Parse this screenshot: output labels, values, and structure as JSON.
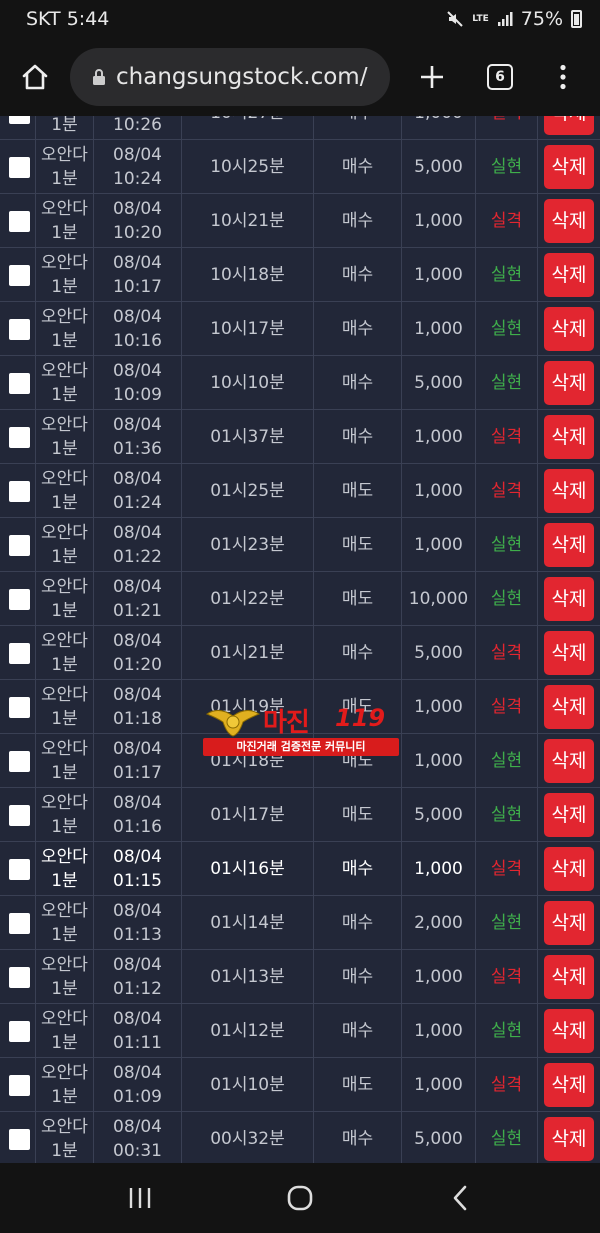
{
  "status": {
    "carrier_time": "SKT 5:44",
    "network": "LTE",
    "battery": "75%"
  },
  "browser": {
    "url": "changsungstock.com/",
    "tab_count": "6"
  },
  "watermark": {
    "title": "마진",
    "number": "119",
    "subtitle": "마진거래 검증전문 커뮤니티"
  },
  "delete_label": "삭제",
  "rows": [
    {
      "name": "오안다",
      "interval": "1분",
      "date": "08/04",
      "time": "10:26",
      "round": "10시27분",
      "type": "매수",
      "amount": "1,000",
      "result": "실격",
      "result_class": "lose"
    },
    {
      "name": "오안다",
      "interval": "1분",
      "date": "08/04",
      "time": "10:24",
      "round": "10시25분",
      "type": "매수",
      "amount": "5,000",
      "result": "실현",
      "result_class": "win"
    },
    {
      "name": "오안다",
      "interval": "1분",
      "date": "08/04",
      "time": "10:20",
      "round": "10시21분",
      "type": "매수",
      "amount": "1,000",
      "result": "실격",
      "result_class": "lose"
    },
    {
      "name": "오안다",
      "interval": "1분",
      "date": "08/04",
      "time": "10:17",
      "round": "10시18분",
      "type": "매수",
      "amount": "1,000",
      "result": "실현",
      "result_class": "win"
    },
    {
      "name": "오안다",
      "interval": "1분",
      "date": "08/04",
      "time": "10:16",
      "round": "10시17분",
      "type": "매수",
      "amount": "1,000",
      "result": "실현",
      "result_class": "win"
    },
    {
      "name": "오안다",
      "interval": "1분",
      "date": "08/04",
      "time": "10:09",
      "round": "10시10분",
      "type": "매수",
      "amount": "5,000",
      "result": "실현",
      "result_class": "win"
    },
    {
      "name": "오안다",
      "interval": "1분",
      "date": "08/04",
      "time": "01:36",
      "round": "01시37분",
      "type": "매수",
      "amount": "1,000",
      "result": "실격",
      "result_class": "lose"
    },
    {
      "name": "오안다",
      "interval": "1분",
      "date": "08/04",
      "time": "01:24",
      "round": "01시25분",
      "type": "매도",
      "amount": "1,000",
      "result": "실격",
      "result_class": "lose"
    },
    {
      "name": "오안다",
      "interval": "1분",
      "date": "08/04",
      "time": "01:22",
      "round": "01시23분",
      "type": "매도",
      "amount": "1,000",
      "result": "실현",
      "result_class": "win"
    },
    {
      "name": "오안다",
      "interval": "1분",
      "date": "08/04",
      "time": "01:21",
      "round": "01시22분",
      "type": "매도",
      "amount": "10,000",
      "result": "실현",
      "result_class": "win"
    },
    {
      "name": "오안다",
      "interval": "1분",
      "date": "08/04",
      "time": "01:20",
      "round": "01시21분",
      "type": "매수",
      "amount": "5,000",
      "result": "실격",
      "result_class": "lose"
    },
    {
      "name": "오안다",
      "interval": "1분",
      "date": "08/04",
      "time": "01:18",
      "round": "01시19분",
      "type": "매도",
      "amount": "1,000",
      "result": "실격",
      "result_class": "lose"
    },
    {
      "name": "오안다",
      "interval": "1분",
      "date": "08/04",
      "time": "01:17",
      "round": "01시18분",
      "type": "매도",
      "amount": "1,000",
      "result": "실현",
      "result_class": "win"
    },
    {
      "name": "오안다",
      "interval": "1분",
      "date": "08/04",
      "time": "01:16",
      "round": "01시17분",
      "type": "매도",
      "amount": "5,000",
      "result": "실현",
      "result_class": "win"
    },
    {
      "name": "오안다",
      "interval": "1분",
      "date": "08/04",
      "time": "01:15",
      "round": "01시16분",
      "type": "매수",
      "amount": "1,000",
      "result": "실격",
      "result_class": "lose",
      "bright": true
    },
    {
      "name": "오안다",
      "interval": "1분",
      "date": "08/04",
      "time": "01:13",
      "round": "01시14분",
      "type": "매수",
      "amount": "2,000",
      "result": "실현",
      "result_class": "win"
    },
    {
      "name": "오안다",
      "interval": "1분",
      "date": "08/04",
      "time": "01:12",
      "round": "01시13분",
      "type": "매수",
      "amount": "1,000",
      "result": "실격",
      "result_class": "lose"
    },
    {
      "name": "오안다",
      "interval": "1분",
      "date": "08/04",
      "time": "01:11",
      "round": "01시12분",
      "type": "매수",
      "amount": "1,000",
      "result": "실현",
      "result_class": "win"
    },
    {
      "name": "오안다",
      "interval": "1분",
      "date": "08/04",
      "time": "01:09",
      "round": "01시10분",
      "type": "매도",
      "amount": "1,000",
      "result": "실격",
      "result_class": "lose"
    },
    {
      "name": "오안다",
      "interval": "1분",
      "date": "08/04",
      "time": "00:31",
      "round": "00시32분",
      "type": "매수",
      "amount": "5,000",
      "result": "실현",
      "result_class": "win"
    }
  ]
}
